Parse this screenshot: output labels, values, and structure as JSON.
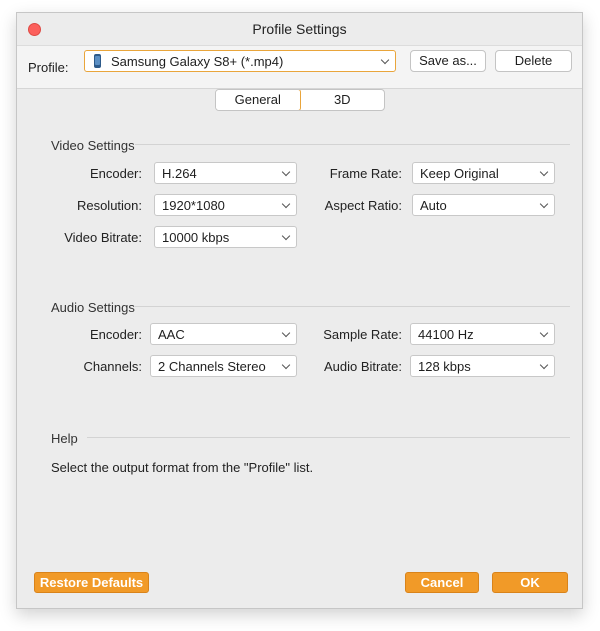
{
  "window": {
    "title": "Profile Settings"
  },
  "profile": {
    "label": "Profile:",
    "value": "Samsung Galaxy S8+ (*.mp4)",
    "device_icon": "phone-icon",
    "save_as_label": "Save as...",
    "delete_label": "Delete"
  },
  "tabs": [
    {
      "label": "General",
      "selected": true
    },
    {
      "label": "3D",
      "selected": false
    }
  ],
  "video": {
    "section_title": "Video Settings",
    "encoder": {
      "label": "Encoder:",
      "value": "H.264"
    },
    "resolution": {
      "label": "Resolution:",
      "value": "1920*1080"
    },
    "bitrate": {
      "label": "Video Bitrate:",
      "value": "10000 kbps"
    },
    "frame_rate": {
      "label": "Frame Rate:",
      "value": "Keep Original"
    },
    "aspect_ratio": {
      "label": "Aspect Ratio:",
      "value": "Auto"
    }
  },
  "audio": {
    "section_title": "Audio Settings",
    "encoder": {
      "label": "Encoder:",
      "value": "AAC"
    },
    "channels": {
      "label": "Channels:",
      "value": "2 Channels Stereo"
    },
    "sample_rate": {
      "label": "Sample Rate:",
      "value": "44100 Hz"
    },
    "bitrate": {
      "label": "Audio Bitrate:",
      "value": "128 kbps"
    }
  },
  "help": {
    "section_title": "Help",
    "text": "Select the output format from the \"Profile\" list."
  },
  "footer": {
    "restore_label": "Restore Defaults",
    "cancel_label": "Cancel",
    "ok_label": "OK"
  },
  "colors": {
    "accent": "#f19a28",
    "close_button": "#fc605c",
    "window_bg": "#ececec"
  }
}
